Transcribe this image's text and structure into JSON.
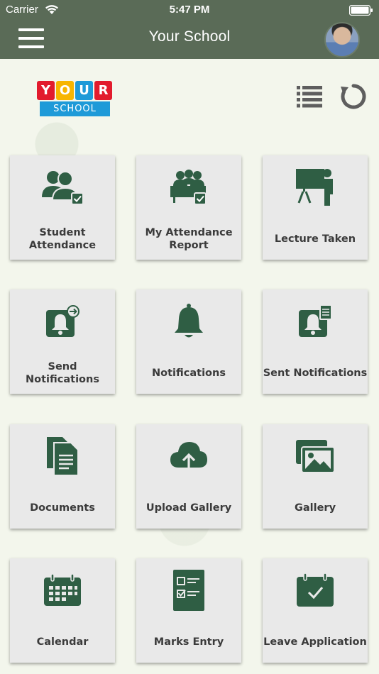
{
  "status_bar": {
    "carrier": "Carrier",
    "time": "5:47 PM"
  },
  "header": {
    "title": "Your School",
    "menu_icon": "hamburger-menu-icon",
    "avatar": "user-avatar"
  },
  "logo": {
    "letters": [
      "Y",
      "O",
      "U",
      "R"
    ],
    "letter_colors": [
      "#e21b2d",
      "#f7b500",
      "#1e9ad8",
      "#e21b2d"
    ],
    "subtitle": "SCHOOL"
  },
  "toolbar": {
    "list_icon": "list-view-icon",
    "refresh_icon": "refresh-icon"
  },
  "colors": {
    "accent": "#2f5e44",
    "header": "#5a6b57",
    "tile_bg": "#e9e9e9"
  },
  "tiles": [
    {
      "label": "Student Attendance",
      "icon": "student-attendance-icon"
    },
    {
      "label": "My Attendance Report",
      "icon": "attendance-report-icon"
    },
    {
      "label": "Lecture Taken",
      "icon": "lecture-icon"
    },
    {
      "label": "Send Notifications",
      "icon": "send-notification-icon"
    },
    {
      "label": "Notifications",
      "icon": "bell-icon"
    },
    {
      "label": "Sent Notifications",
      "icon": "sent-notification-icon"
    },
    {
      "label": "Documents",
      "icon": "documents-icon"
    },
    {
      "label": "Upload Gallery",
      "icon": "cloud-upload-icon"
    },
    {
      "label": "Gallery",
      "icon": "gallery-icon"
    },
    {
      "label": "Calendar",
      "icon": "calendar-icon"
    },
    {
      "label": "Marks Entry",
      "icon": "checklist-icon"
    },
    {
      "label": "Leave Application",
      "icon": "calendar-check-icon"
    }
  ]
}
